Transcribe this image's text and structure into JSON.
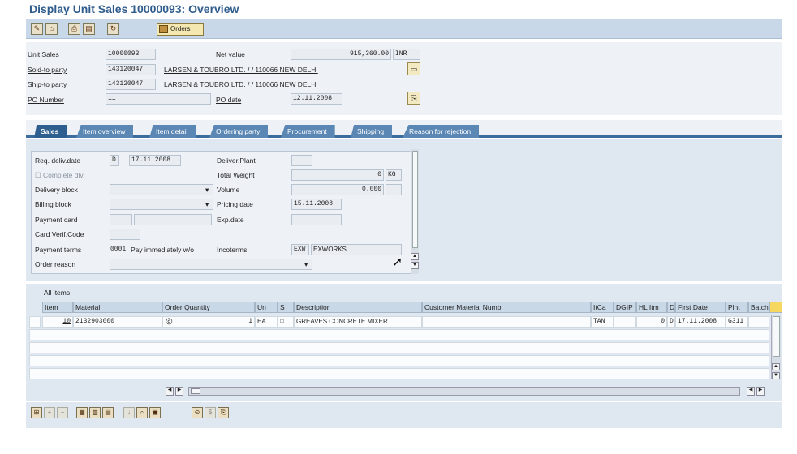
{
  "title": "Display Unit Sales 10000093: Overview",
  "toolbar": {
    "icons": [
      "display-change-icon",
      "header-icon",
      "print-icon",
      "print-preview-icon",
      "refresh-icon"
    ],
    "orders_label": "Orders"
  },
  "header": {
    "unit_sales_label": "Unit Sales",
    "unit_sales_value": "10000093",
    "net_value_label": "Net value",
    "net_value": "915,360.00",
    "currency": "INR",
    "sold_to_label": "Sold-to party",
    "sold_to_id": "143120047",
    "sold_to_name": "LARSEN & TOUBRO LTD. / / 110066 NEW DELHI",
    "ship_to_label": "Ship-to party",
    "ship_to_id": "143120047",
    "ship_to_name": "LARSEN & TOUBRO LTD. / / 110066 NEW DELHI",
    "po_number_label": "PO Number",
    "po_number": "11",
    "po_date_label": "PO date",
    "po_date": "12.11.2008"
  },
  "tabs": [
    "Sales",
    "Item overview",
    "Item detail",
    "Ordering party",
    "Procurement",
    "Shipping",
    "Reason for rejection"
  ],
  "sales": {
    "req_deliv_label": "Req. deliv.date",
    "req_deliv_type": "D",
    "req_deliv_date": "17.11.2008",
    "deliver_plant_label": "Deliver.Plant",
    "deliver_plant": "",
    "complete_dlv_label": "Complete dlv.",
    "total_weight_label": "Total Weight",
    "total_weight": "0",
    "weight_unit": "KG",
    "delivery_block_label": "Delivery block",
    "delivery_block": "",
    "volume_label": "Volume",
    "volume": "0.000",
    "volume_unit": "",
    "billing_block_label": "Billing block",
    "billing_block": "",
    "pricing_date_label": "Pricing date",
    "pricing_date": "15.11.2008",
    "payment_card_label": "Payment card",
    "exp_date_label": "Exp.date",
    "card_verif_label": "Card Verif.Code",
    "payment_terms_label": "Payment terms",
    "payment_terms_code": "0001",
    "payment_terms_text": "Pay immediately w/o",
    "incoterms_label": "Incoterms",
    "incoterms_code": "EXW",
    "incoterms_text": "EXWORKS",
    "order_reason_label": "Order reason",
    "order_reason": ""
  },
  "items": {
    "title": "All items",
    "columns": [
      "Item",
      "Material",
      "Order Quantity",
      "Un",
      "S",
      "Description",
      "Customer Material Numb",
      "ItCa",
      "DGIP",
      "HL Itm",
      "D",
      "First Date",
      "Plnt",
      "Batch"
    ],
    "rows": [
      {
        "item": "10",
        "material": "2132903000",
        "qty": "1",
        "un": "EA",
        "s": "",
        "description": "GREAVES CONCRETE MIXER",
        "cust_mat": "",
        "itca": "TAN",
        "dgip": "",
        "hl_itm": "0",
        "d": "D",
        "first_date": "17.11.2008",
        "plnt": "G311",
        "batch": ""
      }
    ]
  }
}
